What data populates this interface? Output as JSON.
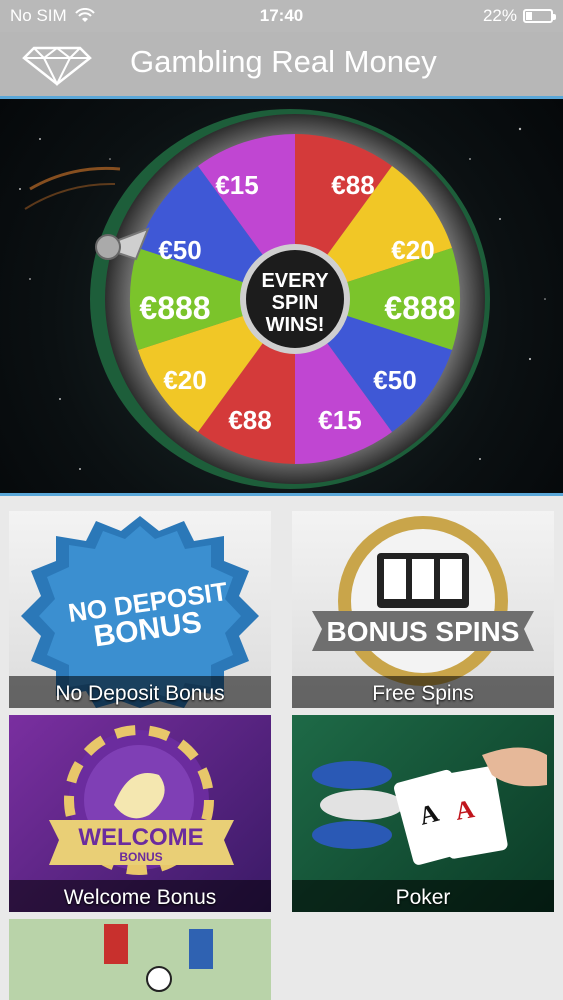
{
  "status": {
    "carrier": "No SIM",
    "time": "17:40",
    "battery": "22%",
    "battery_level": 0.22
  },
  "appbar": {
    "title": "Gambling Real Money",
    "logo_icon": "diamond-icon"
  },
  "hero": {
    "center_text": [
      "EVERY",
      "SPIN",
      "WINS!"
    ],
    "segments": [
      "€15",
      "€88",
      "€20",
      "€888",
      "€50",
      "€15",
      "€88",
      "€20",
      "€888",
      "€50"
    ]
  },
  "tiles": [
    {
      "label": "No Deposit Bonus",
      "badge": [
        "NO DEPOSIT",
        "BONUS"
      ]
    },
    {
      "label": "Free Spins",
      "badge": [
        "BONUS SPINS"
      ]
    },
    {
      "label": "Welcome Bonus",
      "badge": [
        "WELCOME",
        "BONUS"
      ]
    },
    {
      "label": "Poker"
    },
    {
      "label": ""
    }
  ],
  "colors": {
    "statusbar": "#b9b9b9",
    "appbar": "#b7b7b7",
    "accent": "#5aa7d8"
  }
}
